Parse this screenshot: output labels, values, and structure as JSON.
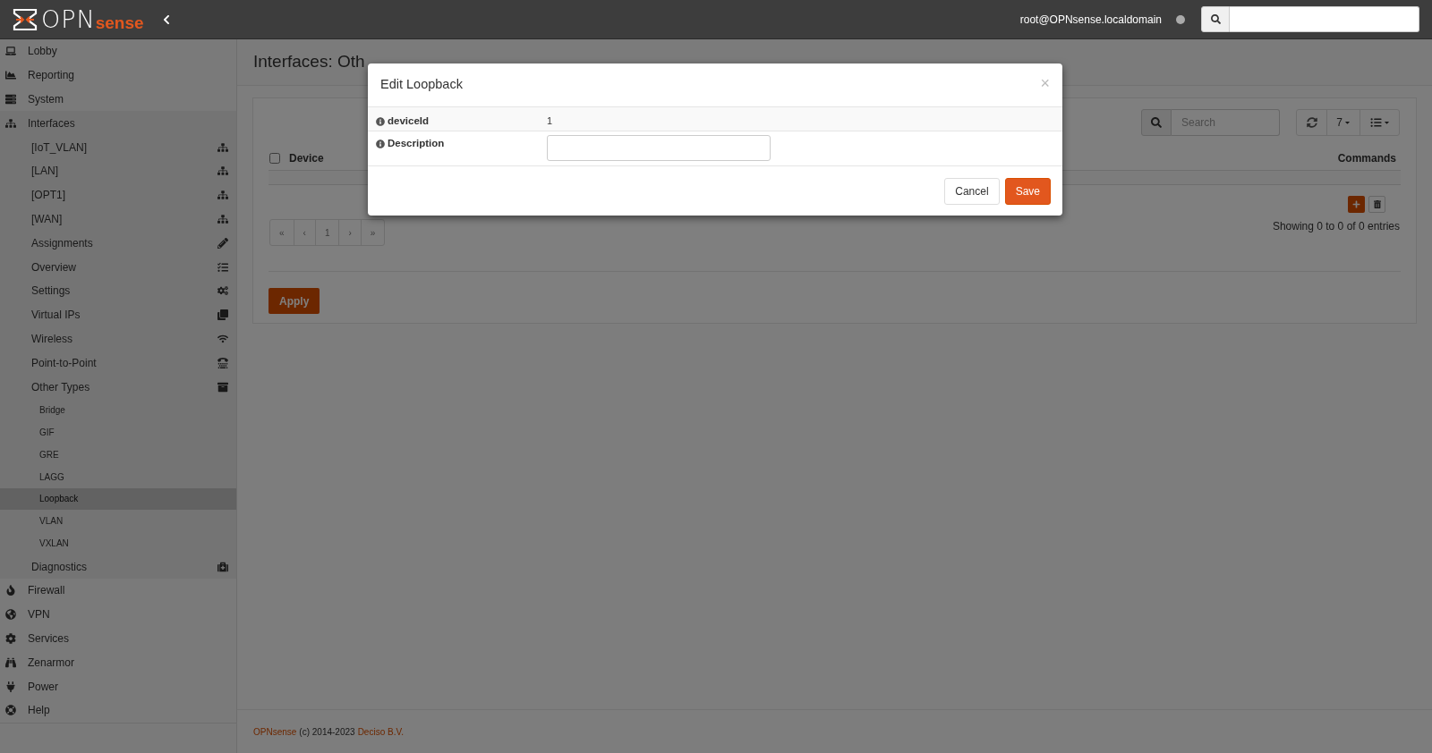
{
  "topbar": {
    "logo": {
      "primary": "OPN",
      "secondary": "sense"
    },
    "user": "root@OPNsense.localdomain"
  },
  "sidebar": {
    "items": [
      {
        "label": "Lobby",
        "selected": false
      },
      {
        "label": "Reporting",
        "selected": false
      },
      {
        "label": "System",
        "selected": false
      },
      {
        "label": "Interfaces",
        "selected": false,
        "children": [
          {
            "label": "[IoT_VLAN]",
            "selected": false
          },
          {
            "label": "[LAN]",
            "selected": false
          },
          {
            "label": "[OPT1]",
            "selected": false
          },
          {
            "label": "[WAN]",
            "selected": false
          },
          {
            "label": "Assignments",
            "selected": false
          },
          {
            "label": "Overview",
            "selected": false
          },
          {
            "label": "Settings",
            "selected": false
          },
          {
            "label": "Virtual IPs",
            "selected": false
          },
          {
            "label": "Wireless",
            "selected": false
          },
          {
            "label": "Point-to-Point",
            "selected": false
          },
          {
            "label": "Other Types",
            "selected": false,
            "children": [
              {
                "label": "Bridge",
                "selected": false
              },
              {
                "label": "GIF",
                "selected": false
              },
              {
                "label": "GRE",
                "selected": false
              },
              {
                "label": "LAGG",
                "selected": false
              },
              {
                "label": "Loopback",
                "selected": true
              },
              {
                "label": "VLAN",
                "selected": false
              },
              {
                "label": "VXLAN",
                "selected": false
              }
            ]
          },
          {
            "label": "Diagnostics",
            "selected": false
          }
        ]
      },
      {
        "label": "Firewall",
        "selected": false
      },
      {
        "label": "VPN",
        "selected": false
      },
      {
        "label": "Services",
        "selected": false
      },
      {
        "label": "Zenarmor",
        "selected": false
      },
      {
        "label": "Power",
        "selected": false
      },
      {
        "label": "Help",
        "selected": false
      }
    ]
  },
  "page": {
    "title": "Interfaces: Oth",
    "grid": {
      "search": {
        "placeholder": "Search"
      },
      "page_size": "7",
      "columns": {
        "select_all": {
          "checked": false
        },
        "device": "Device",
        "commands": "Commands"
      },
      "pagination": [
        "«",
        "‹",
        "1",
        "›",
        "»"
      ],
      "info": "Showing 0 to 0 of 0 entries"
    },
    "apply_button": "Apply"
  },
  "footer": {
    "brand": "OPNsense",
    "text": "(c) 2014-2023",
    "company": "Deciso B.V."
  },
  "dialog": {
    "title": "Edit Loopback",
    "close": "×",
    "fields": [
      {
        "kind": "static",
        "label": "deviceId",
        "value": "1"
      },
      {
        "kind": "input",
        "label": "Description"
      }
    ],
    "buttons": [
      {
        "label": "Cancel",
        "primary": false
      },
      {
        "label": "Save",
        "primary": true
      }
    ]
  }
}
